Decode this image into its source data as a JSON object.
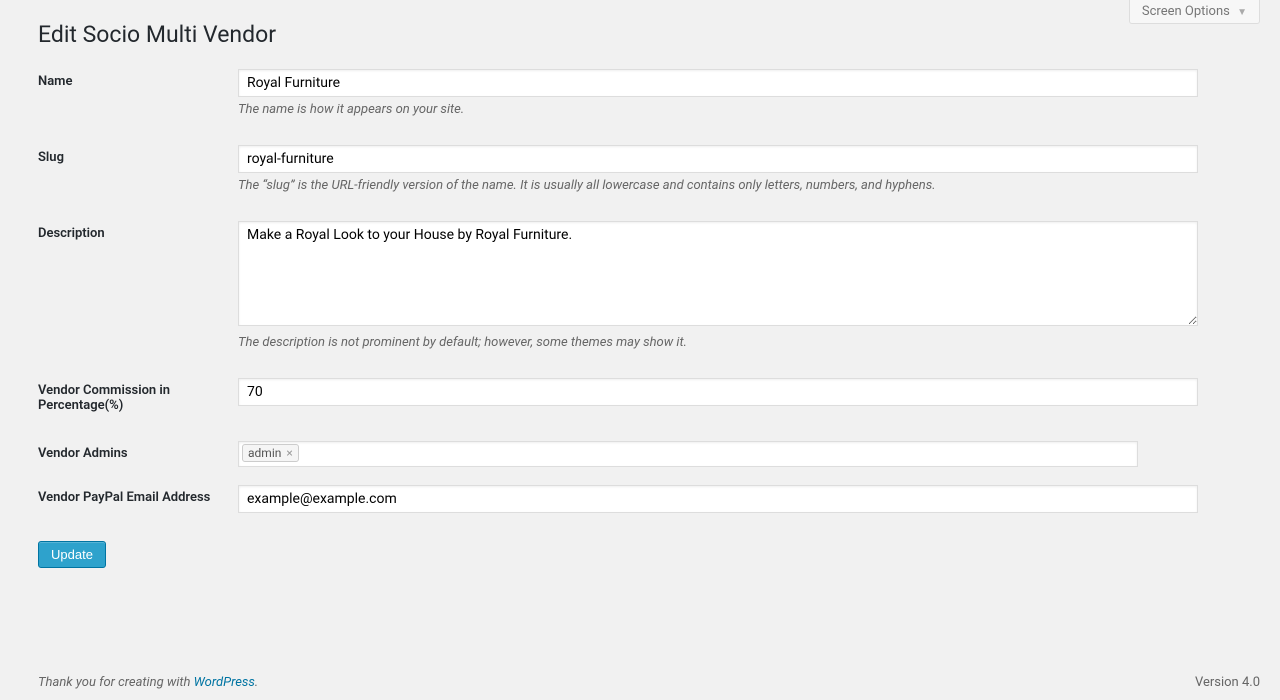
{
  "screen_options_label": "Screen Options",
  "page_title": "Edit Socio Multi Vendor",
  "fields": {
    "name": {
      "label": "Name",
      "value": "Royal Furniture",
      "description": "The name is how it appears on your site."
    },
    "slug": {
      "label": "Slug",
      "value": "royal-furniture",
      "description": "The “slug” is the URL-friendly version of the name. It is usually all lowercase and contains only letters, numbers, and hyphens."
    },
    "description_field": {
      "label": "Description",
      "value": "Make a Royal Look to your House by Royal Furniture.",
      "description": "The description is not prominent by default; however, some themes may show it."
    },
    "commission": {
      "label": "Vendor Commission in Percentage(%)",
      "value": "70"
    },
    "admins": {
      "label": "Vendor Admins",
      "tag": "admin",
      "tag_remove": "×"
    },
    "paypal": {
      "label": "Vendor PayPal Email Address",
      "value": "example@example.com"
    }
  },
  "update_button": "Update",
  "footer": {
    "thanks_prefix": "Thank you for creating with ",
    "wordpress_link": "WordPress",
    "period": ".",
    "version": "Version 4.0"
  }
}
